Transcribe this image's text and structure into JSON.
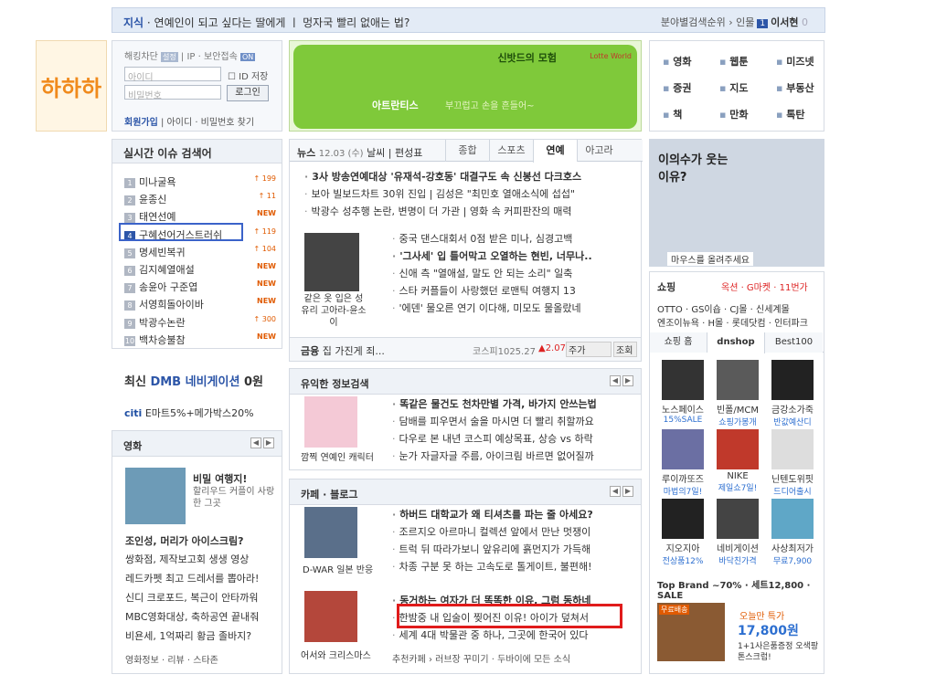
{
  "topbar": {
    "label": "지식",
    "question": "· 연예인이 되고 싶다는 딸에게 ㅣ 멍자국 빨리 없애는 법?",
    "right_prefix": "분야별검색순위 › 인물",
    "rank": "1",
    "name": "이서현",
    "tail": "0"
  },
  "logo": {
    "text": "하하하"
  },
  "login": {
    "hack": "해킹차단",
    "hack_tag": "설정",
    "ip": "IP",
    "secure": "보안접속",
    "secure_tag": "ON",
    "id_placeholder": "아이디",
    "pw_placeholder": "비밀번호",
    "save_id": "ID 저장",
    "login_btn": "로그인",
    "join": "회원가입",
    "find": "아이디 · 비밀번호 찾기"
  },
  "issue": {
    "title": "실시간 이슈 검색어",
    "items": [
      {
        "rank": "1",
        "label": "미나굴욕",
        "change": "↑ 199",
        "type": "up"
      },
      {
        "rank": "2",
        "label": "윤종신",
        "change": "↑ 11",
        "type": "up"
      },
      {
        "rank": "3",
        "label": "태연선예",
        "change": "NEW",
        "type": "new"
      },
      {
        "rank": "4",
        "label": "구혜선어거스트러쉬",
        "change": "↑ 119",
        "type": "up"
      },
      {
        "rank": "5",
        "label": "명세빈복귀",
        "change": "↑ 104",
        "type": "up"
      },
      {
        "rank": "6",
        "label": "김지혜열애설",
        "change": "NEW",
        "type": "new"
      },
      {
        "rank": "7",
        "label": "송윤아 구준엽",
        "change": "NEW",
        "type": "new"
      },
      {
        "rank": "8",
        "label": "서영희돌아이바",
        "change": "NEW",
        "type": "new"
      },
      {
        "rank": "9",
        "label": "박광수논란",
        "change": "↑ 300",
        "type": "up"
      },
      {
        "rank": "10",
        "label": "백차승불참",
        "change": "NEW",
        "type": "new"
      }
    ]
  },
  "dmb": {
    "pre": "최신",
    "brand": "DMB 네비게이션",
    "price": "0원"
  },
  "citi": {
    "logo": "citi",
    "text": "E마트5%+메가박스20%"
  },
  "movie": {
    "title": "영화",
    "feature_title": "비밀 여행지!",
    "feature_sub": "할리우드 커플이 사랑한 그곳",
    "headline": "조인성, 머리가 아이스크림?",
    "items": [
      "쌍화점, 제작보고회 생생 영상",
      "레드카펫 최고 드레서를 뽑아라!",
      "신디 크로포드, 복근이 안타까워",
      "MBC영화대상, 축하공연 끝내줘",
      "비욘세, 1억짜리 황금 졸바지?"
    ],
    "footer": "영화정보 · 리뷰 · 스타존"
  },
  "banner": {
    "title": "신밧드의 모험",
    "line1": "아트란티스",
    "line2": "부끄럽고 손을 흔들어~",
    "logo": "Lotte World"
  },
  "news": {
    "lead": "뉴스",
    "date": "12.03 (수)",
    "weather": "날씨",
    "editorial": "편성표",
    "tabs": [
      "종합",
      "스포츠",
      "연예",
      "아고라"
    ],
    "active_tab": "연예",
    "top": [
      "3사 방송연예대상 '유재석-강호동' 대결구도 속 신봉선 다크호스",
      "보아 빌보드차트 30위 진입 | 김성은 \"최민호 열애소식에 섭섭\"",
      "박광수 성추행 논란, 변명이 더 가관 | 영화 속 커피판잔의 매력"
    ],
    "caption": "같은 옷 입은 성유리 고아라-윤소이",
    "side": [
      "중국 댄스대회서 0점 받은 미나, 심경고백",
      "'그사세' 입 틀어막고 오열하는 현빈, 너무나..",
      "신애 측 \"열애설, 말도 안 되는 소리\" 일축",
      "스타 커플들이 사랑했던 로맨틱 여행지 13",
      "'에덴' 물오른 연기 이다해, 미모도 물올랐네"
    ],
    "stock_label": "금융",
    "stock_text": "집 가진게 죄...",
    "kospi": "코스피1025.27",
    "kospi_change": "▲2.07",
    "stock_input": "주가",
    "stock_btn": "조회"
  },
  "info": {
    "title": "유익한 정보검색",
    "caption": "깜찍 연예인 캐릭터",
    "items": [
      "똑같은 물건도 천차만별 가격, 바가지 안쓰는법",
      "담배를 피우면서 술을 마시면 더 빨리 취할까요",
      "다우로 본 내년 코스피 예상목표, 상승 vs 하락",
      "눈가 자글자글 주름, 아이크림 바르면 없어질까"
    ]
  },
  "cafe": {
    "title": "카페 · 블로그",
    "caption1": "D-WAR 일본 반응",
    "items1": [
      "하버드 대학교가 왜 티셔츠를 파는 줄 아세요?",
      "조르지오 아르마니 컬렉션 앞에서 만난 멋쟁이",
      "트럭 뒤 따라가보니 앞유리에 흙먼지가 가득해",
      "차종 구분 못 하는 고속도로 톨게이트, 불편해!"
    ],
    "caption2": "어서와 크리스마스",
    "items2": [
      "동거하는 여자가 더 똑똑한 이유, 그럼 동하네",
      "한밤중 내 입술이 찢어진 이유! 아이가 덮쳐서",
      "세계 4대 박물관 중 하나, 그곳에 한국어 있다"
    ],
    "footer": "추천카페 › 러브장 꾸미기 · 두바이에 모든 소식"
  },
  "shortcuts": [
    "영화",
    "웹툰",
    "미즈넷",
    "증권",
    "지도",
    "부동산",
    "책",
    "만화",
    "톡탄"
  ],
  "photo": {
    "caption": "이의수가 웃는이유?",
    "hint": "마우스를 올려주세요"
  },
  "shop": {
    "title": "쇼핑",
    "promo": "옥션 · G마켓 · 11번가",
    "links1": "OTTO · GS이숍 · CJ몰 · 신세계몰",
    "links2": "엔조이뉴욕 · H몰 · 롯데닷컴 · 인터파크",
    "tabs": [
      "쇼핑 홈",
      "dnshop",
      "Best100"
    ],
    "active_tab": "dnshop",
    "items": [
      {
        "name": "노스페이스",
        "sub": "15%SALE"
      },
      {
        "name": "빈폴/MCM",
        "sub": "쇼핑가봉개"
      },
      {
        "name": "금강소가죽",
        "sub": "반값예산디"
      },
      {
        "name": "루이까또즈",
        "sub": "마법의7일!"
      },
      {
        "name": "NIKE",
        "sub": "제일쇼7일!"
      },
      {
        "name": "닌텐도위핏",
        "sub": "드디어출시"
      },
      {
        "name": "지오지아",
        "sub": "전상품12%"
      },
      {
        "name": "네비게이션",
        "sub": "바닥친가격"
      },
      {
        "name": "사상최저가",
        "sub": "무료7,900"
      }
    ],
    "brand": "Top Brand ~70% · 세트12,800 · SALE",
    "deal_title": "오늘만 특가",
    "deal_price": "17,800원",
    "deal_desc": "1+1사은품증정 오색팡톤스크럽!",
    "free": "무료배송"
  }
}
